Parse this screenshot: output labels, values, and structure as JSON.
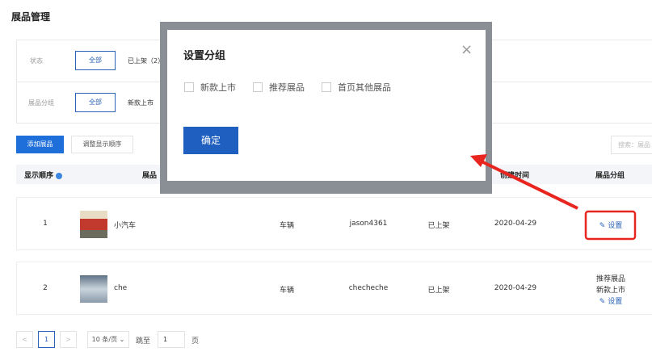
{
  "page": {
    "title": "展品管理"
  },
  "filters": {
    "status_label": "状态",
    "status_all": "全部",
    "status_on": "已上架（2）",
    "group_label": "展品分组",
    "group_all": "全部",
    "group_new": "新款上市"
  },
  "toolbar": {
    "add": "添加展品",
    "reorder": "调整显示顺序",
    "search_placeholder": "搜索：展品"
  },
  "table": {
    "headers": {
      "order": "显示顺序",
      "product": "展品",
      "created": "创建时间",
      "group": "展品分组"
    },
    "rows": [
      {
        "order": "1",
        "name": "小汽车",
        "category": "车辆",
        "creator": "jason4361",
        "status": "已上架",
        "date": "2020-04-29",
        "groups": [],
        "action": "设置"
      },
      {
        "order": "2",
        "name": "che",
        "category": "车辆",
        "creator": "checheche",
        "status": "已上架",
        "date": "2020-04-29",
        "groups": [
          "推荐展品",
          "新款上市"
        ],
        "action": "设置"
      }
    ]
  },
  "pagination": {
    "page": "1",
    "per_page": "10 条/页",
    "jump_label": "跳至",
    "jump_value": "1",
    "page_suffix": "页",
    "prev": "<",
    "next": ">"
  },
  "modal": {
    "title": "设置分组",
    "options": [
      "新款上市",
      "推荐展品",
      "首页其他展品"
    ],
    "confirm": "确定"
  },
  "colors": {
    "primary": "#1e6fd9",
    "annotation": "#e8261f"
  }
}
